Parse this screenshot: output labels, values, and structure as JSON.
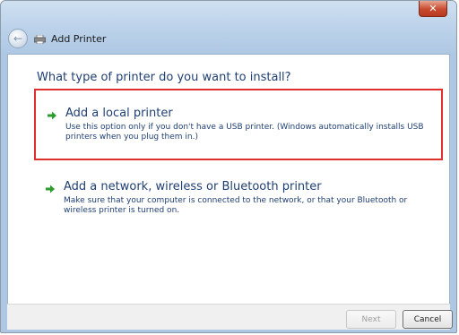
{
  "window": {
    "title": "Add Printer",
    "close_symbol": "✕"
  },
  "icons": {
    "back": "back-arrow-icon",
    "printer": "printer-icon",
    "option_arrow": "green-arrow-icon"
  },
  "main": {
    "question": "What type of printer do you want to install?",
    "options": [
      {
        "title": "Add a local printer",
        "description": "Use this option only if you don't have a USB printer. (Windows automatically installs USB printers when you plug them in.)",
        "highlighted": true
      },
      {
        "title": "Add a network, wireless or Bluetooth printer",
        "description": "Make sure that your computer is connected to the network, or that your Bluetooth or wireless printer is turned on.",
        "highlighted": false
      }
    ]
  },
  "footer": {
    "next_label": "Next",
    "cancel_label": "Cancel",
    "next_enabled": false
  },
  "colors": {
    "highlight_border": "#e02f2f",
    "link_text": "#1f3f73",
    "arrow_green": "#2e9b2e"
  }
}
